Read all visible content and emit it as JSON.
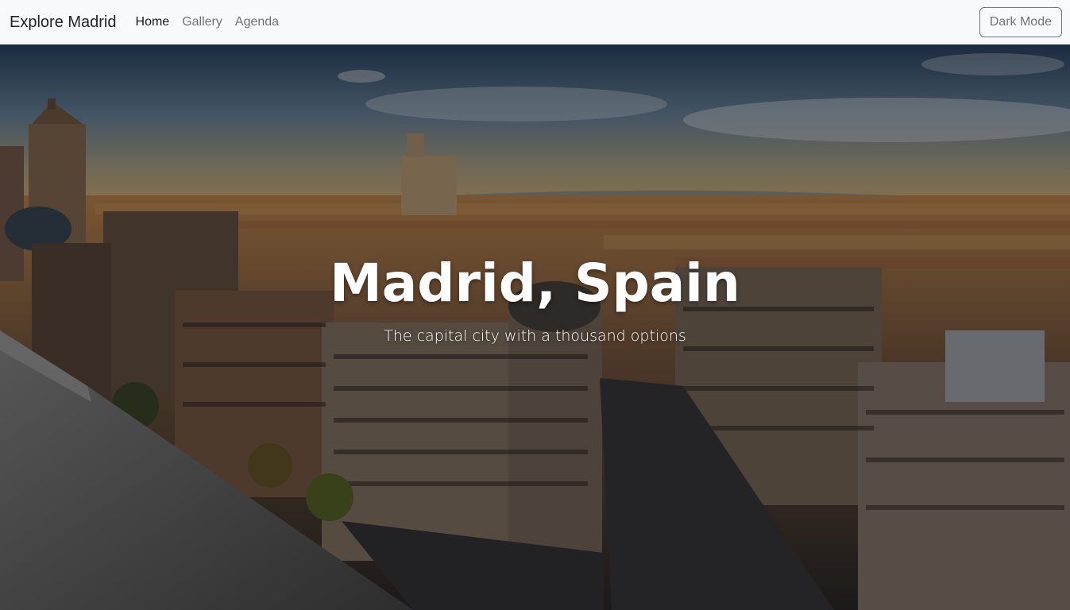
{
  "navbar": {
    "brand": "Explore Madrid",
    "links": [
      {
        "label": "Home",
        "active": true
      },
      {
        "label": "Gallery",
        "active": false
      },
      {
        "label": "Agenda",
        "active": false
      }
    ],
    "dark_mode_label": "Dark Mode"
  },
  "hero": {
    "title": "Madrid, Spain",
    "subtitle": "The capital city with a thousand options"
  },
  "colors": {
    "navbar_bg": "#f8f9fa",
    "sky_top": "#2f4b6e",
    "sky_horizon": "#c9b48c",
    "overlay": "rgba(0,0,0,0.38)"
  }
}
